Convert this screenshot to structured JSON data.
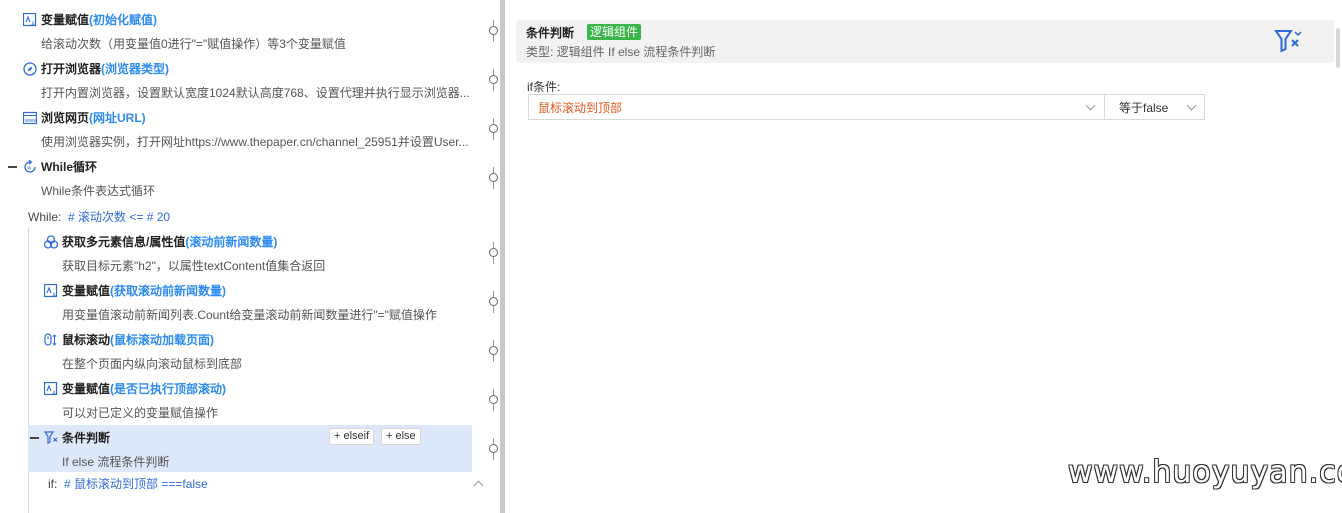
{
  "steps": [
    {
      "title": "变量赋值",
      "param": "(初始化赋值)",
      "desc": "给滚动次数（用变量值0进行\"=\"赋值操作）等3个变量赋值",
      "icon": "variable-assign-icon"
    },
    {
      "title": "打开浏览器",
      "param": "(浏览器类型)",
      "desc": "打开内置浏览器，设置默认宽度1024默认高度768、设置代理并执行显示浏览器...",
      "icon": "compass-icon"
    },
    {
      "title": "浏览网页",
      "param": "(网址URL)",
      "desc": "使用浏览器实例，打开网址https://www.thepaper.cn/channel_25951并设置User...",
      "icon": "web-page-icon"
    },
    {
      "title": "While循环",
      "param": "",
      "desc": "While条件表达式循环",
      "icon": "loop-icon"
    }
  ],
  "while_expr": {
    "label": "While:",
    "value": "# 滚动次数 <= # 20"
  },
  "inner_steps": [
    {
      "title": "获取多元素信息/属性值",
      "param": "(滚动前新闻数量)",
      "desc": "获取目标元素\"h2\"，以属性textContent值集合返回",
      "icon": "multi-element-icon"
    },
    {
      "title": "变量赋值",
      "param": "(获取滚动前新闻数量)",
      "desc": "用变量值滚动前新闻列表.Count给变量滚动前新闻数量进行\"=\"赋值操作",
      "icon": "variable-assign-icon"
    },
    {
      "title": "鼠标滚动",
      "param": "(鼠标滚动加载页面)",
      "desc": "在整个页面内纵向滚动鼠标到底部",
      "icon": "mouse-scroll-icon"
    },
    {
      "title": "变量赋值",
      "param": "(是否已执行顶部滚动)",
      "desc": "可以对已定义的变量赋值操作",
      "icon": "variable-assign-icon"
    },
    {
      "title": "条件判断",
      "param": "",
      "desc": "If else 流程条件判断",
      "icon": "filter-condition-icon"
    }
  ],
  "cond_buttons": {
    "elseif": "+ elseif",
    "else": "+ else"
  },
  "if_expr": {
    "label": "if:",
    "value": "# 鼠标滚动到顶部 ===false"
  },
  "detail": {
    "title": "条件判断",
    "badge": "逻辑组件",
    "type_line": "类型:   逻辑组件 If else 流程条件判断",
    "cond_label": "if条件:",
    "cond_value": "鼠标滚动到顶部",
    "compare_value": "等于false"
  },
  "watermark": "www.huoyuyan.com",
  "colors": {
    "accent": "#2f8cf0",
    "badge": "#3bb54a",
    "cond_value": "#e0581c",
    "highlight": "#dde8fb"
  }
}
